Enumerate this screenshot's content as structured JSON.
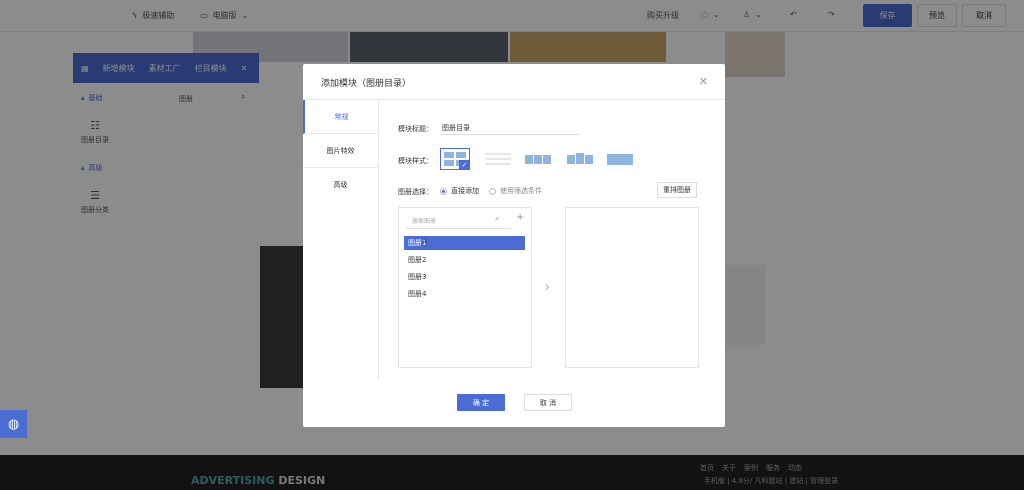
{
  "topbar": {
    "guide": "极速辅助",
    "device": "电脑版",
    "upgrade": "购买升级",
    "save": "保存",
    "preview": "预览",
    "cancel": "取消"
  },
  "panel": {
    "tabs": [
      "新增模块",
      "素材工厂",
      "栏目模块"
    ],
    "section1": "基础",
    "section1_item": "图册目录",
    "col2": "图册",
    "section2": "高级",
    "section2_item": "图册分类"
  },
  "footer": {
    "brand_a": "ADVERTISING",
    "brand_b": "DESIGN",
    "links": [
      "首页",
      "关于",
      "案例",
      "服务",
      "动态"
    ],
    "sub": "手机版 | 4.8分/ 凡科建站 | 建站 | 管理登录"
  },
  "modal": {
    "title": "添加模块（图册目录）",
    "tabs": [
      "常规",
      "图片特效",
      "高级"
    ],
    "module_title_label": "模块标题：",
    "module_title_value": "图册目录",
    "module_style_label": "模块样式：",
    "album_select_label": "图册选择：",
    "radio_direct": "直接添加",
    "radio_filter": "使用筛选条件",
    "reset": "重排图册",
    "search_placeholder": "搜索图册",
    "items": [
      "图册1",
      "图册2",
      "图册3",
      "图册4"
    ],
    "ok": "确 定",
    "cancel": "取 消"
  },
  "colors": {
    "accent": "#4a6cd4",
    "footer_bg": "#222222",
    "overlay": "rgba(0,0,0,0.45)"
  }
}
